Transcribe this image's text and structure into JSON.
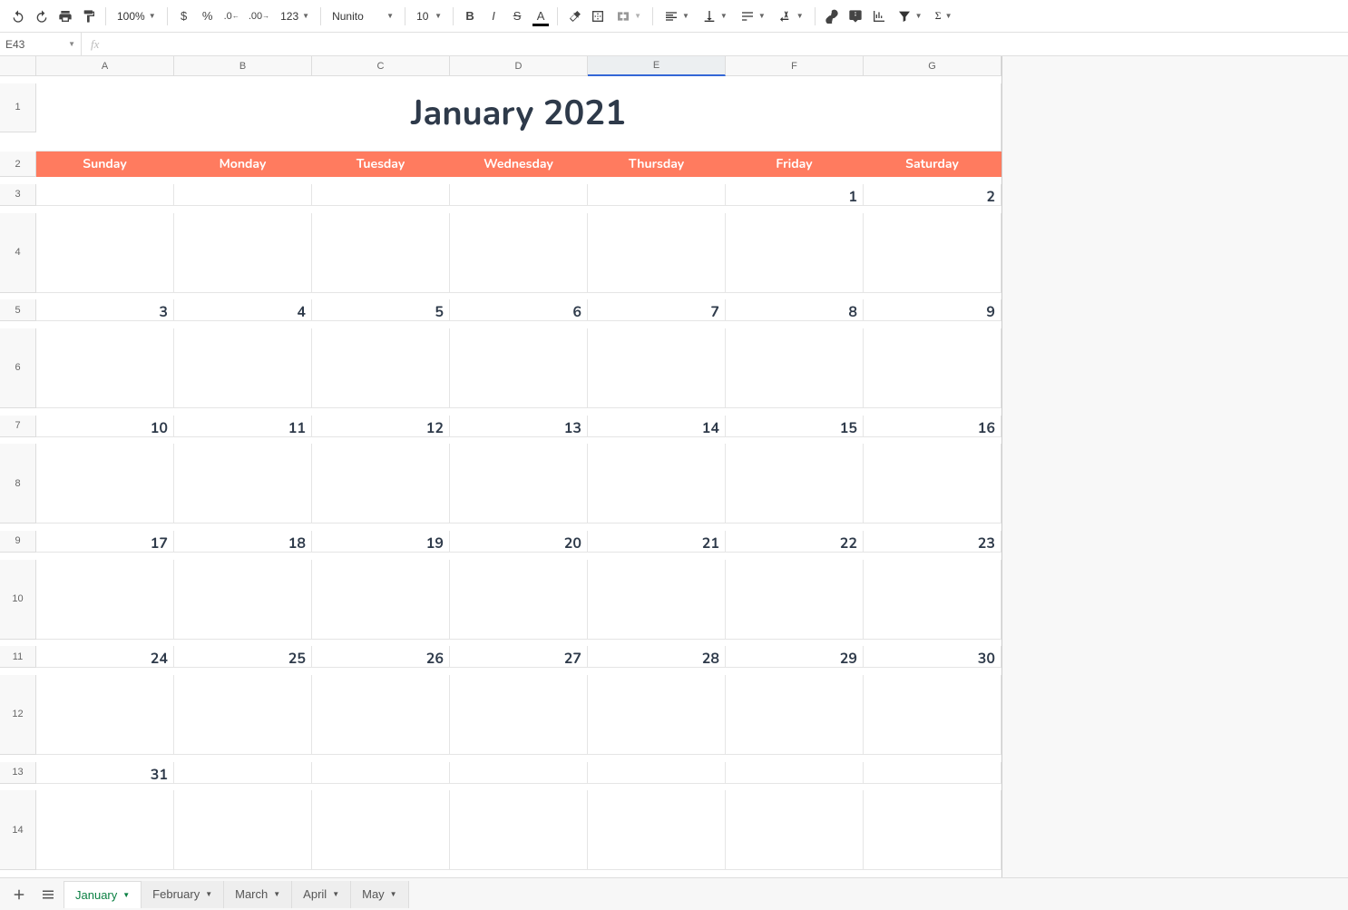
{
  "toolbar": {
    "zoom": "100%",
    "currency": "$",
    "percent": "%",
    "dec_dec": ".0",
    "dec_inc": ".00",
    "more_formats": "123",
    "font": "Nunito",
    "font_size": "10"
  },
  "name_box": "E43",
  "fx_label": "fx",
  "columns": [
    "A",
    "B",
    "C",
    "D",
    "E",
    "F",
    "G"
  ],
  "selected_col_index": 4,
  "calendar": {
    "title": "January 2021",
    "day_headers": [
      "Sunday",
      "Monday",
      "Tuesday",
      "Wednesday",
      "Thursday",
      "Friday",
      "Saturday"
    ],
    "weeks": [
      [
        "",
        "",
        "",
        "",
        "",
        "1",
        "2"
      ],
      [
        "3",
        "4",
        "5",
        "6",
        "7",
        "8",
        "9"
      ],
      [
        "10",
        "11",
        "12",
        "13",
        "14",
        "15",
        "16"
      ],
      [
        "17",
        "18",
        "19",
        "20",
        "21",
        "22",
        "23"
      ],
      [
        "24",
        "25",
        "26",
        "27",
        "28",
        "29",
        "30"
      ],
      [
        "31",
        "",
        "",
        "",
        "",
        "",
        ""
      ]
    ]
  },
  "row_numbers": [
    "1",
    "2",
    "3",
    "4",
    "5",
    "6",
    "7",
    "8",
    "9",
    "10",
    "11",
    "12",
    "13",
    "14"
  ],
  "sheet_tabs": [
    "January",
    "February",
    "March",
    "April",
    "May"
  ],
  "active_tab_index": 0
}
